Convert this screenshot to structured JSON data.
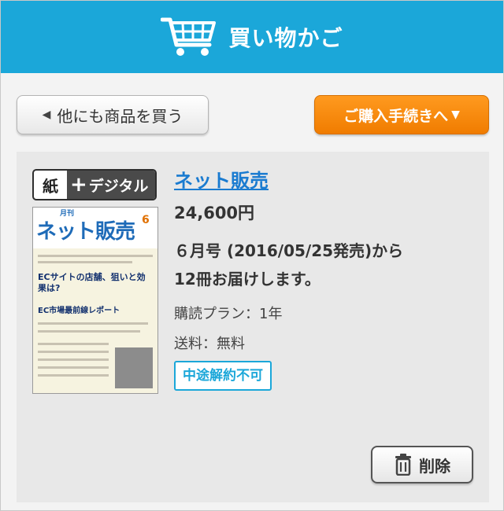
{
  "header": {
    "title": "買い物かご",
    "icon": "shopping-cart-icon"
  },
  "actions": {
    "back_label": "他にも商品を買う",
    "back_icon": "◀",
    "checkout_label": "ご購入手続きへ",
    "checkout_icon": "▼"
  },
  "item": {
    "badge_paper": "紙",
    "badge_plus": "+",
    "badge_digital": "デジタル",
    "cover": {
      "masthead": "ネット販売",
      "gekkan": "月刊",
      "issue_number": "6",
      "headline1": "ECサイトの店舗、狙いと効果は?",
      "headline2": "EC市場最前線レポート"
    },
    "name": "ネット販売",
    "price": "24,600円",
    "delivery_line1": "６月号 (2016/05/25発売)から",
    "delivery_line2": "12冊お届けします。",
    "plan": "購読プラン：1年",
    "shipping": "送料：無料",
    "tag": "中途解約不可",
    "delete_label": "削除",
    "delete_icon": "trash-icon"
  },
  "colors": {
    "header_bg": "#1ba7d9",
    "checkout_bg": "#f08300",
    "link": "#1a7bd0",
    "tag": "#1ba7d9"
  }
}
